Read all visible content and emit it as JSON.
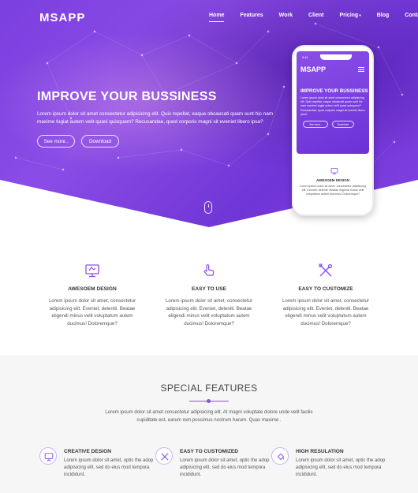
{
  "brand": {
    "logo": "MSAPP"
  },
  "nav": {
    "items": [
      {
        "label": "Home",
        "active": true
      },
      {
        "label": "Features"
      },
      {
        "label": "Work"
      },
      {
        "label": "Client"
      },
      {
        "label": "Pricing"
      },
      {
        "label": "Blog"
      },
      {
        "label": "Contact"
      }
    ]
  },
  "hero": {
    "headline": "IMPROVE YOUR BUSSINESS",
    "text": "Lorem ipsum dolor sit amet consectetur adipisicing elit. Quis repellat, eaque obcaecati quam sunt hic nam maxime fugiat autem velit quasi quisquam? Recusandae, quod corporis magni sit eveniet libero ipsa?",
    "button_more": "See more..",
    "button_download": "Download"
  },
  "phone": {
    "time": "9:41",
    "logo": "MSAPP",
    "headline": "IMPROVE YOUR BUSSINESS",
    "text": "Lorem ipsum dolor sit amet consectetur adipisicing elit. Quis repellat, eaque obcaecati quam sunt hic nam maxime fugiat autem velit quasi quisquam? Recusandae, quod corporis magni sit eveniet libero ipsa?",
    "button_more": "See more..",
    "button_download": "Download",
    "feature_title": "AWESOEM DESIGN",
    "feature_text": "Lorem ipsum dolor sit amet, consectetur adipisicing elit. Eveniet, deleniti. Beatae eligendi minus velit voluptatum autem ducimus! Doloremque?"
  },
  "features": [
    {
      "title": "AWESOEM DESIGN",
      "text": "Lorem ipsum dolor sit amet, consectetur adipisicing elit. Eveniet, deleniti. Beatae eligendi minus velit voluptatum autem ducimus! Doloremque?",
      "icon": "monitor-design-icon"
    },
    {
      "title": "EASY TO USE",
      "text": "Lorem ipsum dolor sit amet, consectetur adipisicing elit. Eveniet, deleniti. Beatae eligendi minus velit voluptatum autem ducimus! Doloremque?",
      "icon": "hand-pointer-icon"
    },
    {
      "title": "EASY TO CUSTOMIZE",
      "text": "Lorem ipsum dolor sit amet, consectetur adipisicing elit. Eveniet, deleniti. Beatae eligendi minus velit voluptatum autem ducimus! Doloremque?",
      "icon": "tools-icon"
    }
  ],
  "special": {
    "title": "SPECIAL FEATURES",
    "text": "Lorem ipsum dolor sit amet consectetur adipisicing elit. At magni voluptate dolore unde velit facilis cupiditate est, earum rem possimus nostrum harum. Quas maxime .",
    "items": [
      {
        "title": "CREATIVE DESIGN",
        "text": "Lorem ipsum dolor sit amet, optic the adop adipisicing elit, sed do eius mod tempora incididunt.",
        "icon": "monitor-design-icon"
      },
      {
        "title": "EASY TO CUSTOMIZED",
        "text": "Lorem ipsum dolor sit amet, optic the adop adipisicing elit, sed do eius mod tempora incididunt.",
        "icon": "tools-icon"
      },
      {
        "title": "HIGH RESULATION",
        "text": "Lorem ipsum dolor sit amet, optic the adop adipisicing elit, sed do eius mod tempora incididunt.",
        "icon": "paint-bucket-icon"
      }
    ]
  },
  "colors": {
    "accent": "#8a4fe8",
    "hero_start": "#7b3fe0",
    "hero_end": "#6f35d6"
  }
}
